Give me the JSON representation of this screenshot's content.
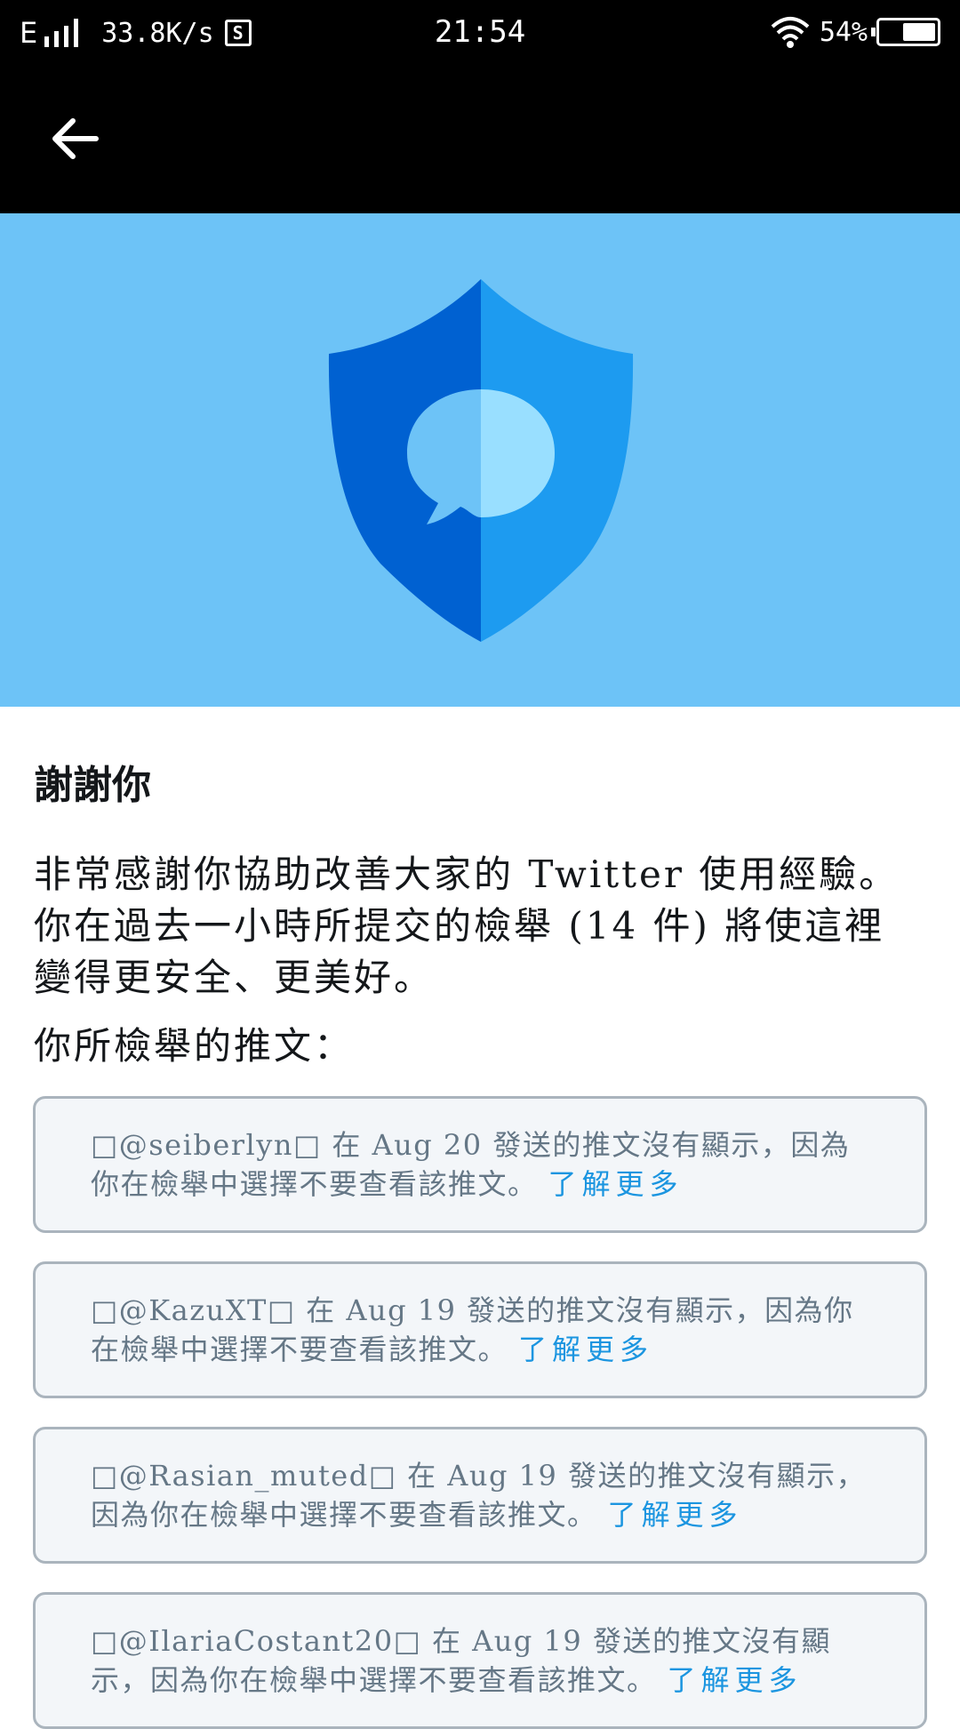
{
  "status_bar": {
    "network": "E",
    "speed": "33.8K/s",
    "s_icon": "S",
    "time": "21:54",
    "battery_pct": "54%",
    "battery_level": 0.54
  },
  "app_bar": {
    "back_icon": "arrow-left-icon"
  },
  "hero": {
    "icon": "shield-chat-icon",
    "colors": {
      "background": "#6dc3f7",
      "shield_dark": "#0061d1",
      "shield_light": "#1d9bf0",
      "bubble_left": "#6dc3f7",
      "bubble_right": "#99dfff"
    }
  },
  "content": {
    "title": "謝謝你",
    "body": "非常感謝你協助改善大家的 Twitter 使用經驗。你在過去一小時所提交的檢舉 (14 件) 將使這裡變得更安全、更美好。",
    "subheading": "你所檢舉的推文："
  },
  "reports": [
    {
      "text": "□@seiberlyn□ 在 Aug 20 發送的推文沒有顯示，因為你在檢舉中選擇不要查看該推文。",
      "link": "了解更多"
    },
    {
      "text": "□@KazuXT□ 在 Aug 19 發送的推文沒有顯示，因為你在檢舉中選擇不要查看該推文。",
      "link": "了解更多"
    },
    {
      "text": "□@Rasian_muted□ 在 Aug 19 發送的推文沒有顯示，因為你在檢舉中選擇不要查看該推文。",
      "link": "了解更多"
    },
    {
      "text": "□@IlariaCostant20□ 在 Aug 19 發送的推文沒有顯示，因為你在檢舉中選擇不要查看該推文。",
      "link": "了解更多"
    }
  ]
}
